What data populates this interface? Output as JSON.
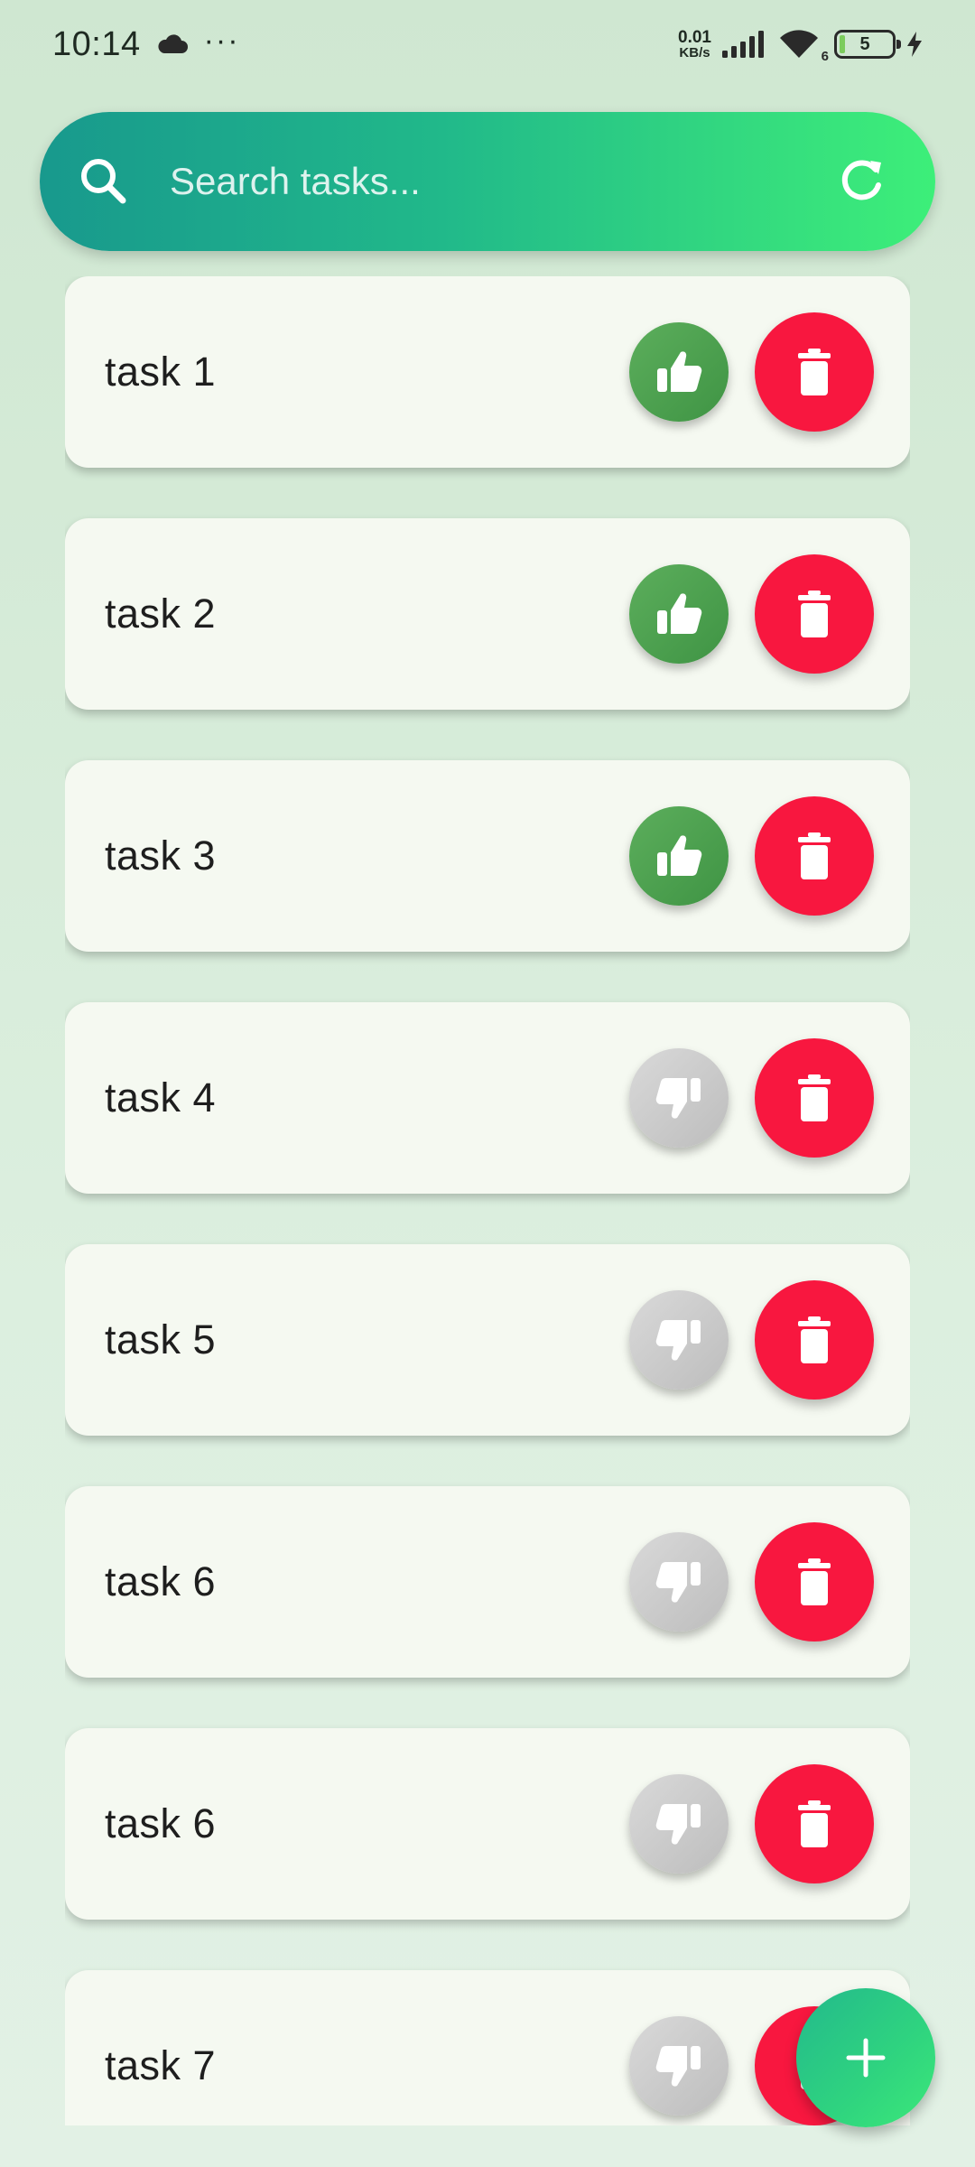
{
  "status_bar": {
    "time": "10:14",
    "more": "···",
    "net_speed_value": "0.01",
    "net_speed_unit": "KB/s",
    "wifi_badge": "6",
    "battery_level": "5"
  },
  "search": {
    "placeholder": "Search tasks...",
    "icon": "search-icon",
    "action_icon": "refresh-icon"
  },
  "tasks": [
    {
      "title": "task 1",
      "vote": "thumbs-up"
    },
    {
      "title": "task 2",
      "vote": "thumbs-up"
    },
    {
      "title": "task 3",
      "vote": "thumbs-up"
    },
    {
      "title": "task 4",
      "vote": "thumbs-down"
    },
    {
      "title": "task 5",
      "vote": "thumbs-down"
    },
    {
      "title": "task 6",
      "vote": "thumbs-down"
    },
    {
      "title": "task 6",
      "vote": "thumbs-down"
    },
    {
      "title": "task 7",
      "vote": "thumbs-down"
    }
  ],
  "fab": {
    "icon": "plus-icon"
  },
  "colors": {
    "search_gradient_start": "#18998d",
    "search_gradient_end": "#3def79",
    "like_green": "#4caf50",
    "dislike_grey": "#c8c8c8",
    "delete_red": "#f8173f",
    "card_bg": "#f5f9f1",
    "page_bg": "#d4ead6"
  }
}
